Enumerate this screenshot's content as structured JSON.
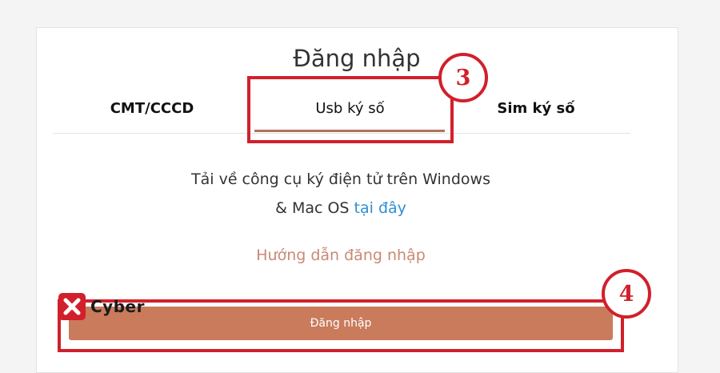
{
  "login": {
    "title": "Đăng nhập",
    "tabs": [
      {
        "label": "CMT/CCCD"
      },
      {
        "label": "Usb ký số"
      },
      {
        "label": "Sim ký số"
      }
    ],
    "download_text_line1": "Tải về công cụ ký điện tử trên Windows",
    "download_text_line2_prefix": "& Mac OS",
    "download_link": "tại đây",
    "guide_link": "Hướng dẫn đăng nhập",
    "login_button": "Đăng nhập"
  },
  "annotations": {
    "step3": "3",
    "step4": "4"
  },
  "watermark": {
    "logo_text": "Cyber",
    "icon": "x-logo-icon"
  },
  "colors": {
    "annotation_red": "#d1202b",
    "button_brown": "#c97b5c",
    "link_blue": "#2e8fd4",
    "guide_color": "#c88a74"
  }
}
